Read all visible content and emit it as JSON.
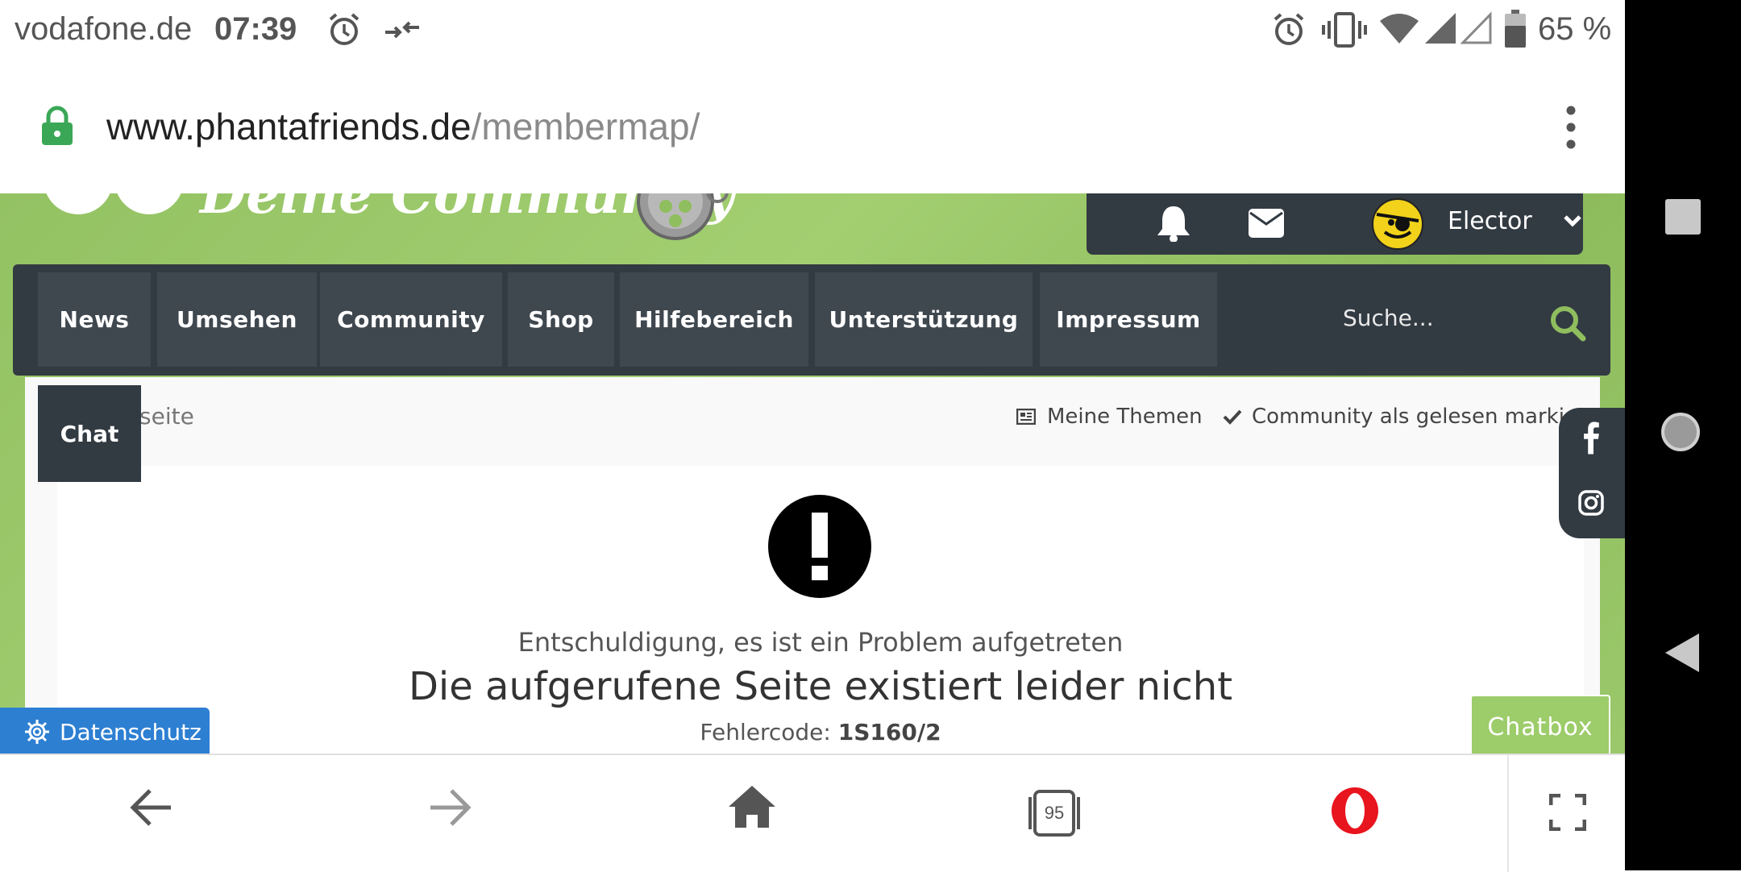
{
  "status_bar": {
    "carrier": "vodafone.de",
    "time": "07:39",
    "battery_percent": "65 %",
    "icons": [
      "alarm-icon",
      "data-saver-icon",
      "alarm-icon",
      "vibrate-icon",
      "wifi-icon",
      "signal-icon",
      "signal-empty-icon",
      "battery-icon"
    ]
  },
  "url_bar": {
    "domain": "www.phantafriends.de",
    "path": "/membermap/",
    "lock_icon": "lock-icon",
    "menu_icon": "more-vert-icon"
  },
  "site": {
    "logo_text": "Deine Community",
    "user_panel": {
      "username": "Elector",
      "icons": [
        "bell-icon",
        "mail-icon",
        "avatar",
        "chevron-down-icon"
      ]
    },
    "nav": [
      {
        "label": "News"
      },
      {
        "label": "Umsehen"
      },
      {
        "label": "Community"
      },
      {
        "label": "Shop"
      },
      {
        "label": "Hilfebereich"
      },
      {
        "label": "Unterstützung"
      },
      {
        "label": "Impressum"
      }
    ],
    "search": {
      "placeholder": "Suche..."
    },
    "breadcrumb": "seite",
    "actions": {
      "my_topics": "Meine Themen",
      "mark_read": "Community als gelesen markieren"
    },
    "chat_tab": "Chat",
    "error": {
      "intro": "Entschuldigung, es ist ein Problem aufgetreten",
      "title": "Die aufgerufene Seite existiert leider nicht",
      "code_label": "Fehlercode:",
      "code_value": "1S160/2"
    },
    "datenschutz": "Datenschutz",
    "chatbox": "Chatbox",
    "social": [
      "facebook-icon",
      "instagram-icon"
    ]
  },
  "toolbar": {
    "tab_count": "95",
    "icons": [
      "back-arrow-icon",
      "forward-arrow-icon",
      "home-icon",
      "tabs-icon",
      "opera-icon",
      "fullscreen-icon"
    ]
  },
  "colors": {
    "site_green": "#8fbe5e",
    "nav_dark": "#323a42",
    "nav_item": "#3f474f",
    "datenschutz_blue": "#2d7fd2",
    "opera_red": "#e8141e",
    "lock_green": "#3aa757"
  }
}
